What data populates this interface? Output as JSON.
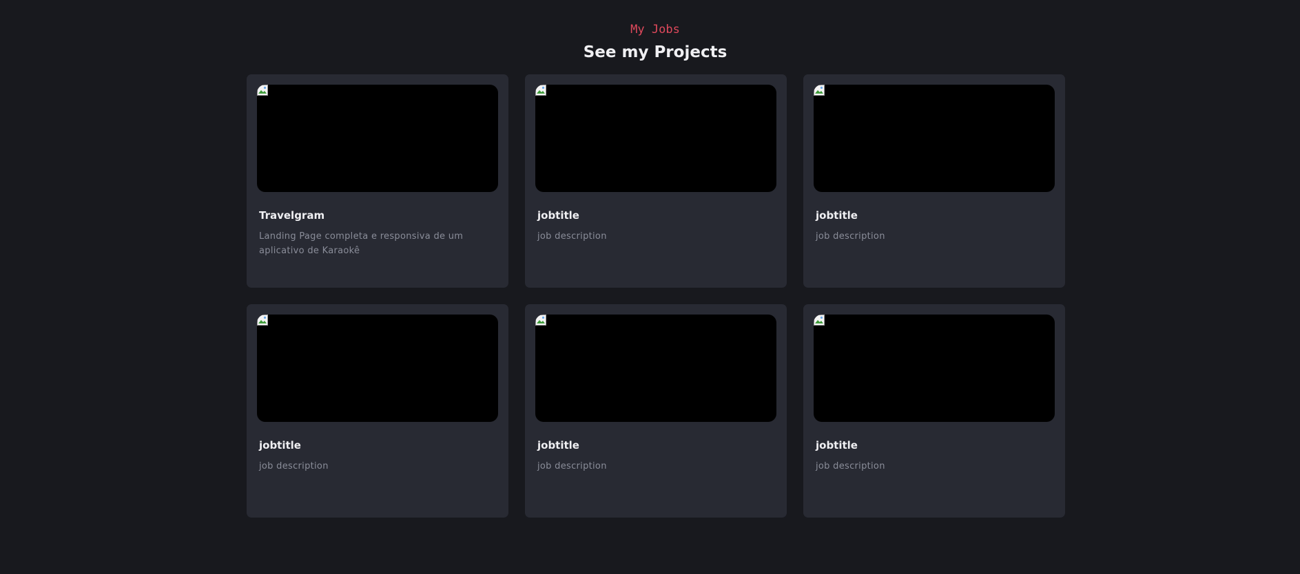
{
  "header": {
    "subtitle": "My Jobs",
    "title": "See my Projects"
  },
  "projects": [
    {
      "title": "Travelgram",
      "description": "Landing Page completa e responsiva de um aplicativo de Karaokê",
      "image_icon": "broken-image-icon"
    },
    {
      "title": "jobtitle",
      "description": "job description",
      "image_icon": "broken-image-icon"
    },
    {
      "title": "jobtitle",
      "description": "job description",
      "image_icon": "broken-image-icon"
    },
    {
      "title": "jobtitle",
      "description": "job description",
      "image_icon": "broken-image-icon"
    },
    {
      "title": "jobtitle",
      "description": "job description",
      "image_icon": "broken-image-icon"
    },
    {
      "title": "jobtitle",
      "description": "job description",
      "image_icon": "broken-image-icon"
    }
  ],
  "colors": {
    "background": "#18191e",
    "card": "#282a33",
    "accent": "#e0495c",
    "heading": "#f0f0f3",
    "muted_text": "#8a8d99"
  }
}
